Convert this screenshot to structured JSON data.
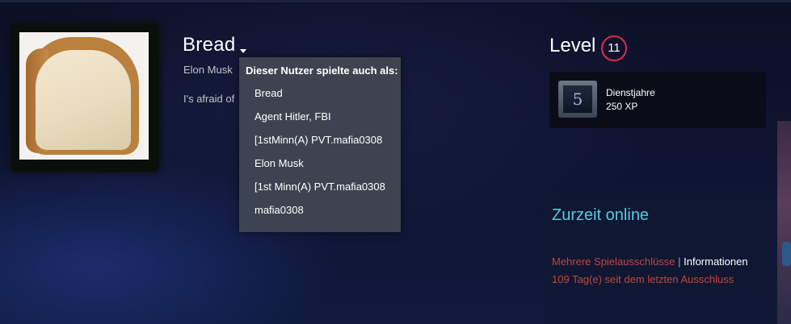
{
  "profile": {
    "persona_name": "Bread",
    "real_name": "Elon Musk",
    "summary": "I's afraid of"
  },
  "alias_dropdown": {
    "header": "Dieser Nutzer spielte auch als:",
    "items": [
      "Bread",
      "Agent Hitler, FBI",
      "[1stMinn(A) PVT.mafia0308",
      "Elon Musk",
      "[1st Minn(A) PVT.mafia0308",
      "mafia0308"
    ]
  },
  "level": {
    "label": "Level",
    "value": "11"
  },
  "badge": {
    "icon_value": "5",
    "title": "Dienstjahre",
    "xp": "250 XP"
  },
  "status": {
    "online": "Zurzeit online",
    "bans": "Mehrere Spielausschlüsse",
    "separator": "|",
    "info_link": "Informationen",
    "days_since": "109 Tag(e) seit dem letzten Ausschluss"
  },
  "colors": {
    "online": "#57cbde",
    "ban": "#c4453f",
    "level_ring": "#e02a45",
    "dropdown_bg": "#3d4450"
  },
  "icons": {
    "dropdown": "caret-down-icon",
    "years_badge": "years-of-service-icon"
  }
}
